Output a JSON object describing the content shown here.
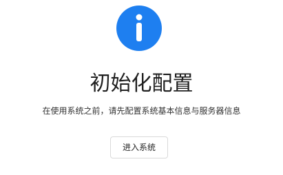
{
  "result": {
    "icon": "info-icon",
    "icon_color": "#1e7ff0",
    "title": "初始化配置",
    "subtitle": "在使用系统之前，请先配置系统基本信息与服务器信息",
    "action_label": "进入系统"
  }
}
